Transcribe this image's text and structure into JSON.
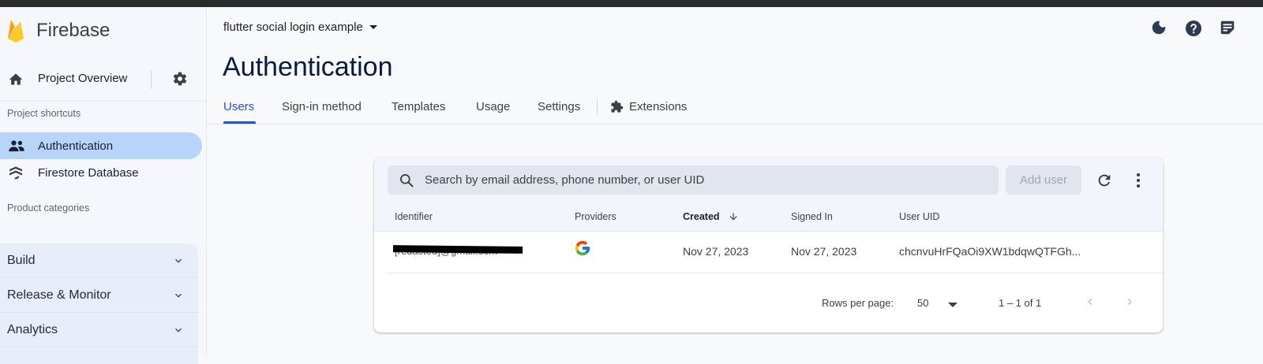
{
  "app": {
    "name": "Firebase"
  },
  "sidebar": {
    "overview_label": "Project Overview",
    "shortcuts_title": "Project shortcuts",
    "shortcuts": [
      {
        "label": "Authentication",
        "active": true,
        "icon": "people-icon"
      },
      {
        "label": "Firestore Database",
        "active": false,
        "icon": "firestore-icon"
      }
    ],
    "categories_title": "Product categories",
    "categories": [
      {
        "label": "Build"
      },
      {
        "label": "Release & Monitor"
      },
      {
        "label": "Analytics"
      }
    ]
  },
  "header": {
    "project_name": "flutter social login example",
    "title": "Authentication",
    "icons": [
      "dark-mode-icon",
      "help-icon",
      "notes-icon"
    ]
  },
  "tabs": [
    {
      "label": "Users",
      "active": true
    },
    {
      "label": "Sign-in method"
    },
    {
      "label": "Templates"
    },
    {
      "label": "Usage"
    },
    {
      "label": "Settings"
    },
    {
      "label": "Extensions",
      "icon": "extensions-icon"
    }
  ],
  "users_table": {
    "search_placeholder": "Search by email address, phone number, or user UID",
    "add_user_label": "Add user",
    "columns": [
      "Identifier",
      "Providers",
      "Created",
      "Signed In",
      "User UID"
    ],
    "sort_column": "Created",
    "rows": [
      {
        "identifier": "[redacted]@gmail.com",
        "provider": "google",
        "created": "Nov 27, 2023",
        "signed_in": "Nov 27, 2023",
        "uid": "chcnvuHrFQaOi9XW1bdqwQTFGh..."
      }
    ],
    "rows_per_page_label": "Rows per page:",
    "rows_per_page_value": "50",
    "page_range": "1 – 1 of 1"
  },
  "colors": {
    "accent": "#1a56db",
    "active_nav": "#b8d4f8",
    "topbar": "#2b2b2b"
  }
}
